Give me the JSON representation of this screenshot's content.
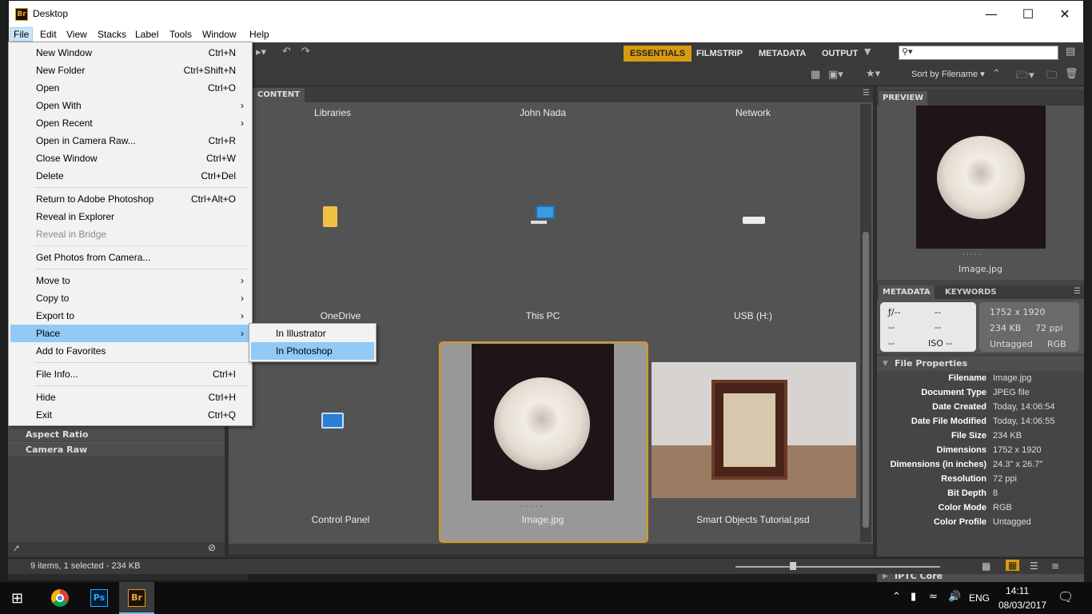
{
  "window": {
    "app_icon": "Br",
    "title": "Desktop"
  },
  "menubar": [
    "File",
    "Edit",
    "View",
    "Stacks",
    "Label",
    "Tools",
    "Window",
    "Help"
  ],
  "workspaces": [
    "ESSENTIALS",
    "FILMSTRIP",
    "METADATA",
    "OUTPUT"
  ],
  "sort_label": "Sort by Filename",
  "content_tab": "CONTENT",
  "items": [
    {
      "label": "Libraries"
    },
    {
      "label": "John Nada"
    },
    {
      "label": "Network"
    },
    {
      "label": "OneDrive"
    },
    {
      "label": "This PC"
    },
    {
      "label": "USB (H:)"
    },
    {
      "label": "Control Panel"
    },
    {
      "label": "Image.jpg"
    },
    {
      "label": "Smart Objects Tutorial.psd"
    }
  ],
  "left_panels": [
    "Aspect Ratio",
    "Camera Raw"
  ],
  "preview": {
    "tab": "PREVIEW",
    "caption": "Image.jpg"
  },
  "meta_tabs": [
    "METADATA",
    "KEYWORDS"
  ],
  "meta_grid": {
    "f": "ƒ/--",
    "a": "--",
    "b": "--",
    "c": "--",
    "d": "--",
    "iso": "ISO --",
    "dims": "1752 x 1920",
    "size": "234 KB",
    "ppi": "72 ppi",
    "profile": "Untagged",
    "mode": "RGB"
  },
  "file_properties_header": "File Properties",
  "file_properties": [
    {
      "k": "Filename",
      "v": "Image.jpg"
    },
    {
      "k": "Document Type",
      "v": "JPEG file"
    },
    {
      "k": "Date Created",
      "v": "Today, 14:06:54"
    },
    {
      "k": "Date File Modified",
      "v": "Today, 14:06:55"
    },
    {
      "k": "File Size",
      "v": "234 KB"
    },
    {
      "k": "Dimensions",
      "v": "1752 x 1920"
    },
    {
      "k": "Dimensions (in inches)",
      "v": "24.3\" x 26.7\""
    },
    {
      "k": "Resolution",
      "v": "72 ppi"
    },
    {
      "k": "Bit Depth",
      "v": "8"
    },
    {
      "k": "Color Mode",
      "v": "RGB"
    },
    {
      "k": "Color Profile",
      "v": "Untagged"
    }
  ],
  "iptc_header": "IPTC Core",
  "status": "9 items, 1 selected - 234 KB",
  "file_menu": [
    {
      "label": "New Window",
      "shortcut": "Ctrl+N"
    },
    {
      "label": "New Folder",
      "shortcut": "Ctrl+Shift+N"
    },
    {
      "label": "Open",
      "shortcut": "Ctrl+O"
    },
    {
      "label": "Open With",
      "shortcut": ""
    },
    {
      "label": "Open Recent",
      "shortcut": ""
    },
    {
      "label": "Open in Camera Raw...",
      "shortcut": "Ctrl+R"
    },
    {
      "label": "Close Window",
      "shortcut": "Ctrl+W"
    },
    {
      "label": "Delete",
      "shortcut": "Ctrl+Del"
    },
    {
      "label": "Return to Adobe Photoshop",
      "shortcut": "Ctrl+Alt+O"
    },
    {
      "label": "Reveal in Explorer",
      "shortcut": ""
    },
    {
      "label": "Reveal in Bridge",
      "shortcut": ""
    },
    {
      "label": "Get Photos from Camera...",
      "shortcut": ""
    },
    {
      "label": "Move to",
      "shortcut": ""
    },
    {
      "label": "Copy to",
      "shortcut": ""
    },
    {
      "label": "Export to",
      "shortcut": ""
    },
    {
      "label": "Place",
      "shortcut": ""
    },
    {
      "label": "Add to Favorites",
      "shortcut": ""
    },
    {
      "label": "File Info...",
      "shortcut": "Ctrl+I"
    },
    {
      "label": "Hide",
      "shortcut": "Ctrl+H"
    },
    {
      "label": "Exit",
      "shortcut": "Ctrl+Q"
    }
  ],
  "place_submenu": [
    "In Illustrator",
    "In Photoshop"
  ],
  "taskbar": {
    "lang": "ENG",
    "time": "14:11",
    "date": "08/03/2017",
    "ps": "Ps",
    "br": "Br"
  },
  "colors": {
    "accent": "#d89b0f",
    "menu_highlight": "#91c9f7",
    "panel": "#535353"
  }
}
